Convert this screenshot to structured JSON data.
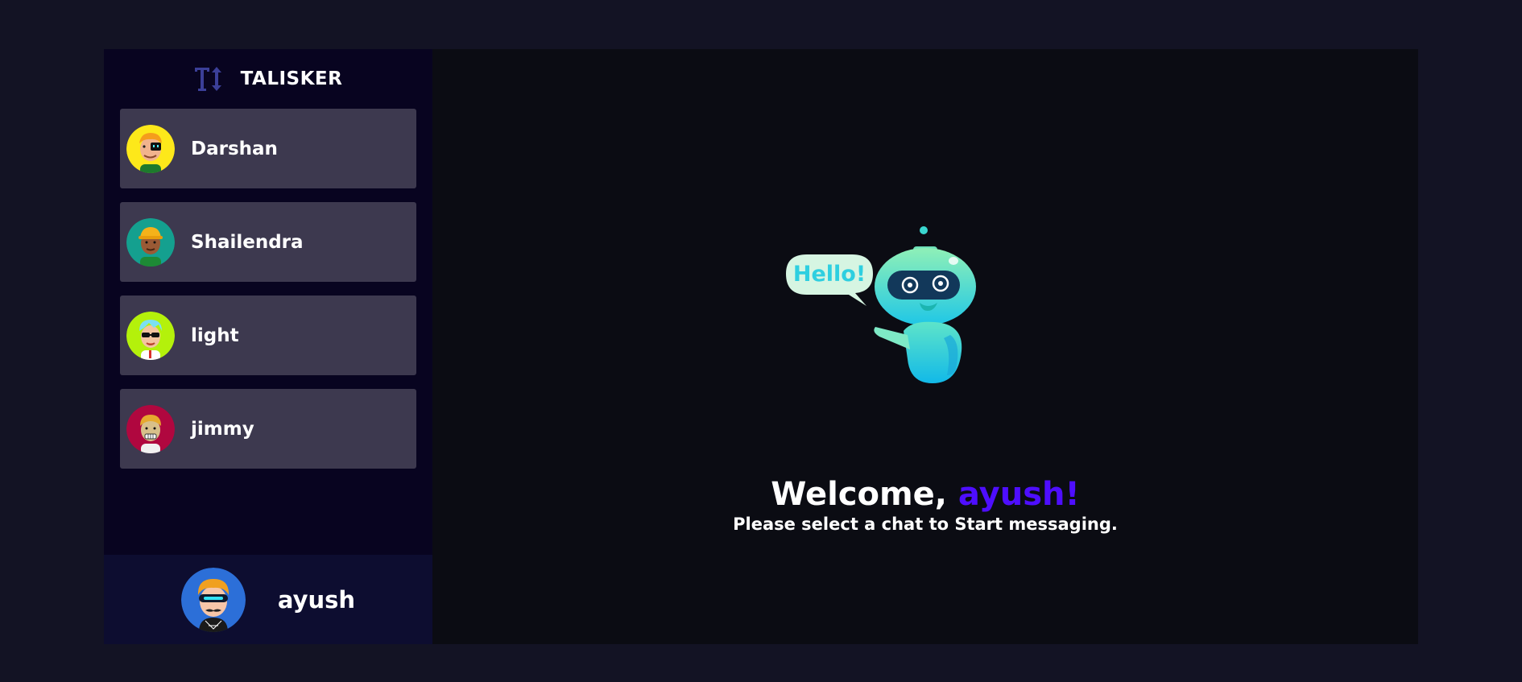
{
  "brand": {
    "name": "TALISKER",
    "logo_icon": "text-height-icon"
  },
  "contacts": [
    {
      "name": "Darshan",
      "avatar_icon": "avatar-darshan-icon",
      "bg": "#fde81a"
    },
    {
      "name": "Shailendra",
      "avatar_icon": "avatar-shailendra-icon",
      "bg": "#14a08f"
    },
    {
      "name": "light",
      "avatar_icon": "avatar-light-icon",
      "bg": "#b4f10b"
    },
    {
      "name": "jimmy",
      "avatar_icon": "avatar-jimmy-icon",
      "bg": "#b0073f"
    }
  ],
  "current_user": {
    "name": "ayush",
    "avatar_icon": "avatar-ayush-icon",
    "bg": "#2c6fd8"
  },
  "welcome": {
    "greeting": "Welcome, ",
    "username": "ayush!",
    "subtitle": "Please select a chat to Start messaging."
  },
  "robot": {
    "speech_text": "Hello!"
  },
  "colors": {
    "accent": "#4e0eff",
    "sidebar_bg": "#080420",
    "contact_bg": "#3d394f",
    "user_bar_bg": "#0d0d30",
    "page_bg": "#131324"
  }
}
